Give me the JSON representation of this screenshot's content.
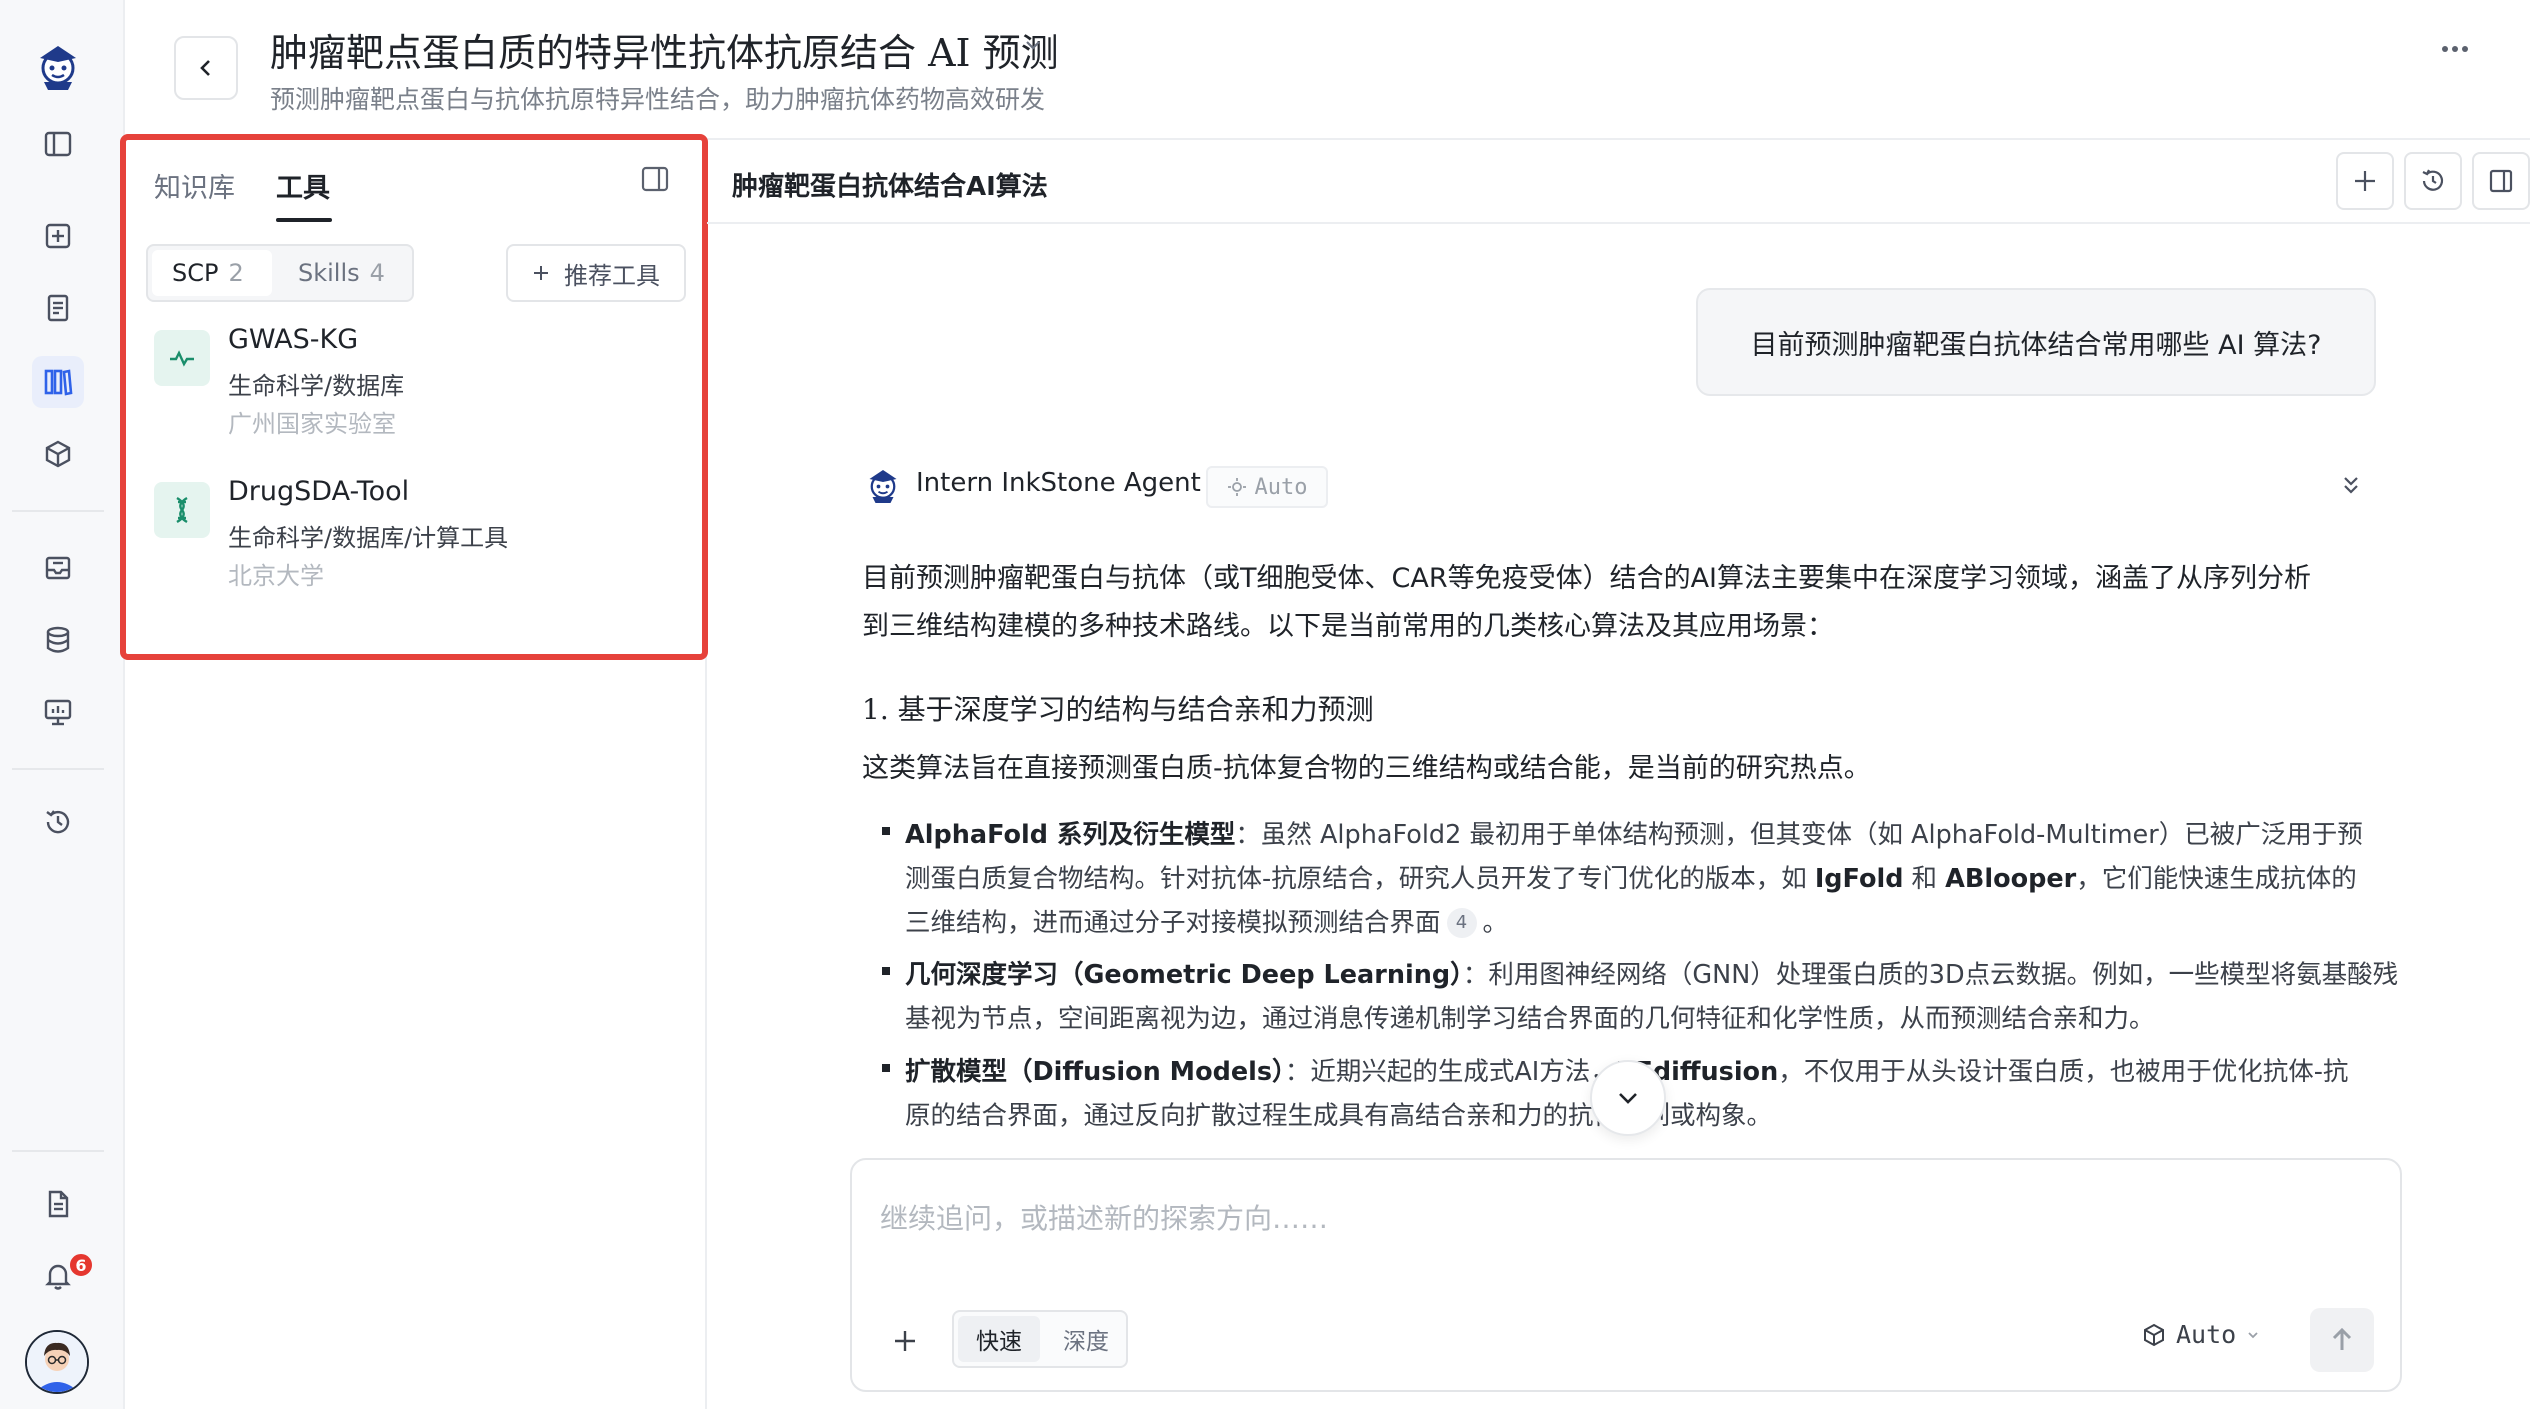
{
  "header": {
    "title": "肿瘤靶点蛋白质的特异性抗体抗原结合 AI 预测",
    "subtitle": "预测肿瘤靶点蛋白与抗体抗原特异性结合，助力肿瘤抗体药物高效研发"
  },
  "rail": {
    "notification_count": "6"
  },
  "left_panel": {
    "tabs": [
      {
        "label": "知识库",
        "active": false
      },
      {
        "label": "工具",
        "active": true
      }
    ],
    "segments": [
      {
        "label": "SCP",
        "count": "2",
        "active": true
      },
      {
        "label": "Skills",
        "count": "4",
        "active": false
      }
    ],
    "recommend_label": "推荐工具",
    "tools": [
      {
        "name": "GWAS-KG",
        "category": "生命科学/数据库",
        "org": "广州国家实验室",
        "icon": "pulse-icon"
      },
      {
        "name": "DrugSDA-Tool",
        "category": "生命科学/数据库/计算工具",
        "org": "北京大学",
        "icon": "dna-icon"
      }
    ]
  },
  "chat": {
    "title": "肿瘤靶蛋白抗体结合AI算法",
    "user_message": "目前预测肿瘤靶蛋白抗体结合常用哪些 AI 算法?",
    "agent_name": "Intern InkStone Agent",
    "agent_mode": "Auto",
    "intro_line1": "目前预测肿瘤靶蛋白与抗体（或T细胞受体、CAR等免疫受体）结合的AI算法主要集中在深度学习领域，涵盖了从序列分析",
    "intro_line2": "到三维结构建模的多种技术路线。以下是当前常用的几类核心算法及其应用场景：",
    "section1_heading": "1. 基于深度学习的结构与结合亲和力预测",
    "section1_desc": "这类算法旨在直接预测蛋白质-抗体复合物的三维结构或结合能，是当前的研究热点。",
    "bullets": [
      {
        "term": "AlphaFold 系列及衍生模型",
        "line1": "：虽然 AlphaFold2 最初用于单体结构预测，但其变体（如 AlphaFold-Multimer）已被广泛用于预",
        "line2_a": "测蛋白质复合物结构。针对抗体-抗原结合，研究人员开发了专门优化的版本，如 ",
        "line2_b1": "IgFold",
        "line2_c": " 和 ",
        "line2_b2": "ABlooper",
        "line2_d": "，它们能快速生成抗体的",
        "line3": "三维结构，进而通过分子对接模拟预测结合界面",
        "cite": "4",
        "line3_end": "。"
      },
      {
        "term": "几何深度学习（Geometric Deep Learning）",
        "line1": "：利用图神经网络（GNN）处理蛋白质的3D点云数据。例如，一些模型将氨基酸残",
        "line2": "基视为节点，空间距离视为边，通过消息传递机制学习结合界面的几何特征和化学性质，从而预测结合亲和力。"
      },
      {
        "term": "扩散模型（Diffusion Models）",
        "line1_a": "：近期兴起的生成式AI方法，",
        "line1_b": "RFdiffusion",
        "line1_c": "，不仅用于从头设计蛋白质，也被用于优化抗体-抗",
        "line2": "原的结合界面，通过反向扩散过程生成具有高结合亲和力的抗体序列或构象。"
      }
    ]
  },
  "input": {
    "placeholder": "继续追问，或描述新的探索方向……",
    "modes": [
      "快速",
      "深度"
    ],
    "model": "Auto"
  }
}
